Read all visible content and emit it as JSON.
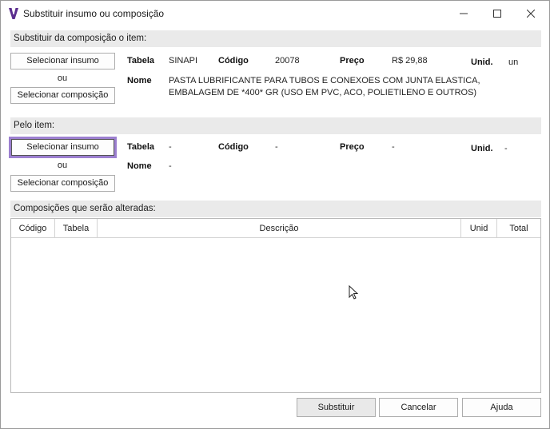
{
  "window": {
    "title": "Substituir insumo ou composição",
    "minimize": "—",
    "maximize": "☐",
    "close": "✕"
  },
  "from_section": {
    "header": "Substituir da composição o item:",
    "select_insumo": "Selecionar insumo",
    "or": "ou",
    "select_composicao": "Selecionar composição",
    "tabela_label": "Tabela",
    "tabela_value": "SINAPI",
    "codigo_label": "Código",
    "codigo_value": "20078",
    "preco_label": "Preço",
    "preco_value": "R$ 29,88",
    "unid_label": "Unid.",
    "unid_value": "un",
    "nome_label": "Nome",
    "nome_value": "PASTA LUBRIFICANTE PARA TUBOS E CONEXOES COM JUNTA ELASTICA, EMBALAGEM DE *400* GR (USO EM PVC, ACO, POLIETILENO E OUTROS)"
  },
  "to_section": {
    "header": "Pelo item:",
    "select_insumo": "Selecionar insumo",
    "or": "ou",
    "select_composicao": "Selecionar composição",
    "tabela_label": "Tabela",
    "tabela_value": "-",
    "codigo_label": "Código",
    "codigo_value": "-",
    "preco_label": "Preço",
    "preco_value": "-",
    "unid_label": "Unid.",
    "unid_value": "-",
    "nome_label": "Nome",
    "nome_value": "-"
  },
  "compositions": {
    "header": "Composições que serão alteradas:",
    "columns": [
      "Código",
      "Tabela",
      "Descrição",
      "Unid",
      "Total"
    ],
    "rows": []
  },
  "footer": {
    "substituir": "Substituir",
    "cancelar": "Cancelar",
    "ajuda": "Ajuda"
  },
  "colors": {
    "accent_focus": "#9c7fd0",
    "logo": "#5b2d8e",
    "section_bg": "#eaeaea"
  },
  "icons": {
    "logo": "app-logo-icon",
    "cursor": "mouse-pointer-icon"
  }
}
